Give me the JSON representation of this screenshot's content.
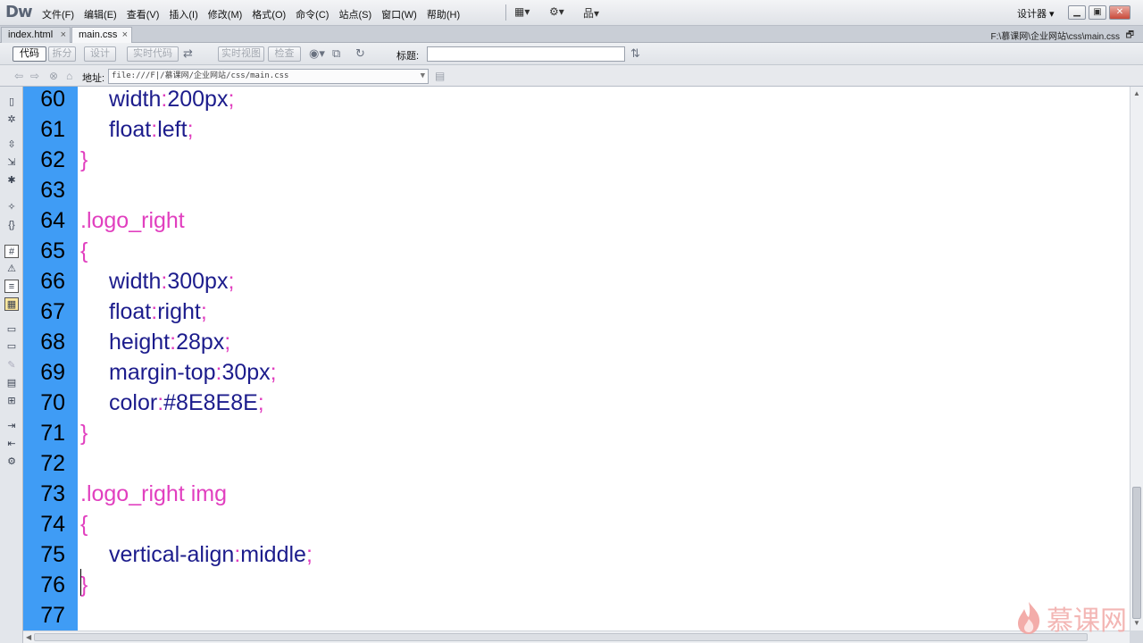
{
  "app": {
    "logo": "Dw"
  },
  "menus": [
    "文件(F)",
    "编辑(E)",
    "查看(V)",
    "插入(I)",
    "修改(M)",
    "格式(O)",
    "命令(C)",
    "站点(S)",
    "窗口(W)",
    "帮助(H)"
  ],
  "workspace": {
    "label": "设计器 ▾"
  },
  "tabs": [
    {
      "label": "index.html",
      "close": "×"
    },
    {
      "label": "main.css",
      "close": "×"
    }
  ],
  "file_path": "F:\\慕课网\\企业网站\\css\\main.css",
  "doc_toolbar": {
    "code": "代码",
    "split": "拆分",
    "design": "设计",
    "live_code": "实时代码",
    "live_view": "实时视图",
    "inspect": "检查",
    "title_label": "标题:"
  },
  "address": {
    "label": "地址:",
    "value": "file:///F|/慕课网/企业网站/css/main.css"
  },
  "code_lines": [
    {
      "num": "60",
      "indent": true,
      "tokens": [
        {
          "t": "width",
          "c": "prop"
        },
        {
          "t": ":",
          "c": "colon"
        },
        {
          "t": "200px",
          "c": "val"
        },
        {
          "t": ";",
          "c": "semi"
        }
      ]
    },
    {
      "num": "61",
      "indent": true,
      "tokens": [
        {
          "t": "float",
          "c": "prop"
        },
        {
          "t": ":",
          "c": "colon"
        },
        {
          "t": "left",
          "c": "val"
        },
        {
          "t": ";",
          "c": "semi"
        }
      ]
    },
    {
      "num": "62",
      "indent": false,
      "tokens": [
        {
          "t": "}",
          "c": "brace"
        }
      ]
    },
    {
      "num": "63",
      "indent": false,
      "tokens": []
    },
    {
      "num": "64",
      "indent": false,
      "tokens": [
        {
          "t": ".logo_right",
          "c": "sel"
        }
      ]
    },
    {
      "num": "65",
      "indent": false,
      "tokens": [
        {
          "t": "{",
          "c": "brace"
        }
      ]
    },
    {
      "num": "66",
      "indent": true,
      "tokens": [
        {
          "t": "width",
          "c": "prop"
        },
        {
          "t": ":",
          "c": "colon"
        },
        {
          "t": "300px",
          "c": "val"
        },
        {
          "t": ";",
          "c": "semi"
        }
      ]
    },
    {
      "num": "67",
      "indent": true,
      "tokens": [
        {
          "t": "float",
          "c": "prop"
        },
        {
          "t": ":",
          "c": "colon"
        },
        {
          "t": "right",
          "c": "val"
        },
        {
          "t": ";",
          "c": "semi"
        }
      ]
    },
    {
      "num": "68",
      "indent": true,
      "tokens": [
        {
          "t": "height",
          "c": "prop"
        },
        {
          "t": ":",
          "c": "colon"
        },
        {
          "t": "28px",
          "c": "val"
        },
        {
          "t": ";",
          "c": "semi"
        }
      ]
    },
    {
      "num": "69",
      "indent": true,
      "tokens": [
        {
          "t": "margin-top",
          "c": "prop"
        },
        {
          "t": ":",
          "c": "colon"
        },
        {
          "t": "30px",
          "c": "val"
        },
        {
          "t": ";",
          "c": "semi"
        }
      ]
    },
    {
      "num": "70",
      "indent": true,
      "tokens": [
        {
          "t": "color",
          "c": "prop"
        },
        {
          "t": ":",
          "c": "colon"
        },
        {
          "t": "#8E8E8E",
          "c": "val"
        },
        {
          "t": ";",
          "c": "semi"
        }
      ]
    },
    {
      "num": "71",
      "indent": false,
      "tokens": [
        {
          "t": "}",
          "c": "brace"
        }
      ]
    },
    {
      "num": "72",
      "indent": false,
      "tokens": []
    },
    {
      "num": "73",
      "indent": false,
      "tokens": [
        {
          "t": ".logo_right img",
          "c": "sel"
        }
      ]
    },
    {
      "num": "74",
      "indent": false,
      "tokens": [
        {
          "t": "{",
          "c": "brace"
        }
      ]
    },
    {
      "num": "75",
      "indent": true,
      "tokens": [
        {
          "t": "vertical-align",
          "c": "prop"
        },
        {
          "t": ":",
          "c": "colon"
        },
        {
          "t": "middle",
          "c": "val"
        },
        {
          "t": ";",
          "c": "semi"
        }
      ]
    },
    {
      "num": "76",
      "indent": false,
      "tokens": [
        {
          "t": "}",
          "c": "brace"
        }
      ]
    },
    {
      "num": "77",
      "indent": false,
      "tokens": []
    }
  ],
  "colors": {
    "gutter": "#3f9cf5",
    "selector": "#e13fbf",
    "property": "#1c1c8c"
  },
  "watermark": {
    "text": "慕课网"
  }
}
